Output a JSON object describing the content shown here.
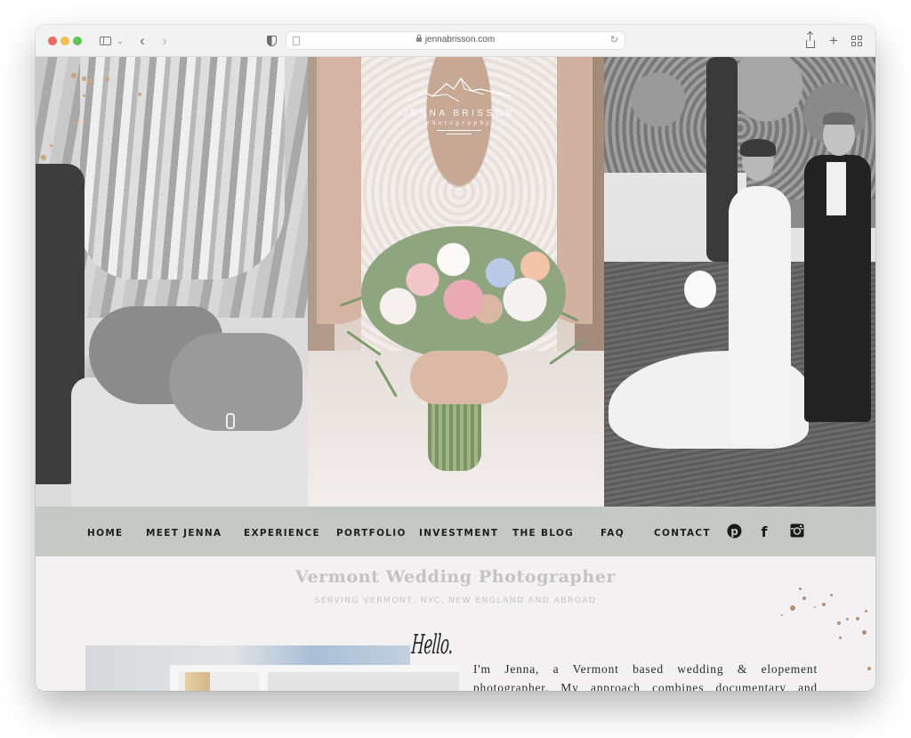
{
  "browser": {
    "url": "jennabrisson.com",
    "controls": {
      "close": "close",
      "minimize": "minimize",
      "zoom": "zoom"
    }
  },
  "site": {
    "logo": {
      "name": "JENNA BRISSON",
      "tagline": "photography"
    },
    "nav": {
      "items": [
        {
          "label": "HOME"
        },
        {
          "label": "MEET JENNA"
        },
        {
          "label": "EXPERIENCE"
        },
        {
          "label": "PORTFOLIO"
        },
        {
          "label": "INVESTMENT"
        },
        {
          "label": "THE BLOG"
        },
        {
          "label": "FAQ"
        },
        {
          "label": "CONTACT"
        }
      ],
      "social": [
        {
          "name": "pinterest",
          "glyph": "P"
        },
        {
          "name": "facebook",
          "glyph": "f"
        },
        {
          "name": "instagram",
          "glyph": "instagram"
        }
      ]
    },
    "hero_photos": [
      {
        "subject": "bride and groom hands at back of dress (black & white)"
      },
      {
        "subject": "bride holding pastel bouquet (color)"
      },
      {
        "subject": "bride and groom walking under tree (black & white)"
      }
    ],
    "main": {
      "title": "Vermont Wedding Photographer",
      "subtitle": "SERVING VERMONT, NYC, NEW ENGLAND AND ABROAD",
      "hello": "Hello.",
      "about_text": "I'm Jenna, a Vermont based wedding & elopement photographer. My approach combines documentary and"
    }
  },
  "colors": {
    "nav_bg": "#c5c9c5",
    "page_bg": "#f3f1f1",
    "title_gray": "#c4c2c2",
    "accent_gold": "#b2907a"
  }
}
